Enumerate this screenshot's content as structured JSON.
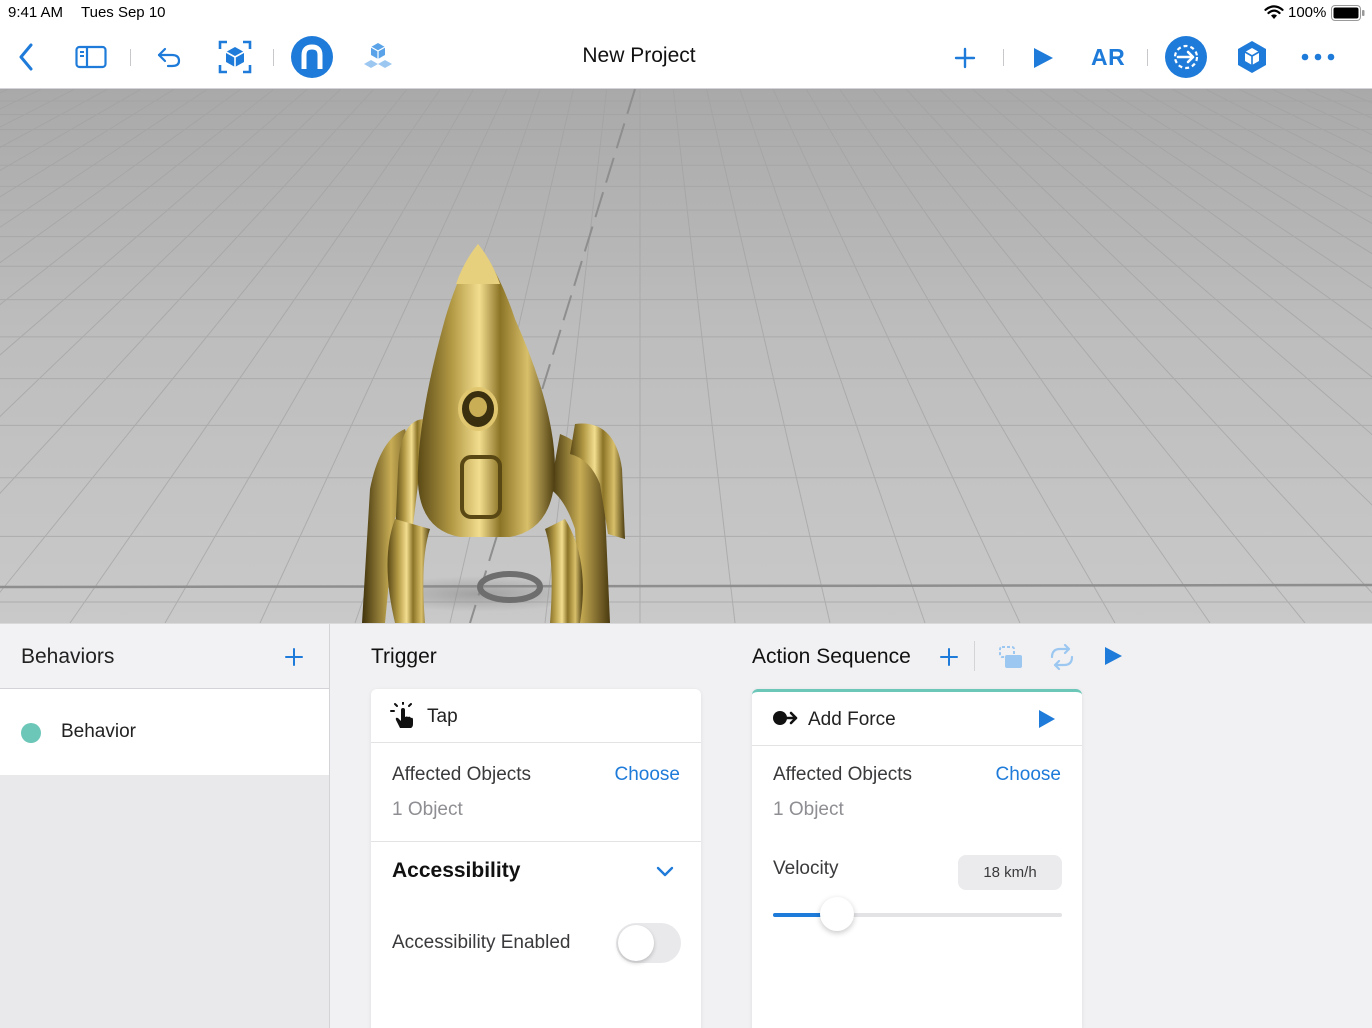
{
  "status": {
    "time": "9:41 AM",
    "date": "Tues Sep 10",
    "battery": "100%"
  },
  "toolbar": {
    "title": "New Project",
    "ar_label": "AR",
    "icons": [
      "back-icon",
      "sidebar-icon",
      "undo-icon",
      "anchor-icon",
      "snap-icon",
      "scene-icon",
      "add-icon",
      "play-icon",
      "behaviors-icon",
      "properties-icon",
      "more-icon"
    ]
  },
  "behaviors": {
    "title": "Behaviors",
    "items": [
      {
        "label": "Behavior",
        "color": "#6cc7b9"
      }
    ]
  },
  "trigger": {
    "title": "Trigger",
    "name": "Tap",
    "affected_label": "Affected Objects",
    "choose": "Choose",
    "count": "1 Object",
    "accessibility_title": "Accessibility",
    "accessibility_enabled_label": "Accessibility Enabled",
    "accessibility_enabled": false
  },
  "actions": {
    "title": "Action Sequence",
    "name": "Add Force",
    "affected_label": "Affected Objects",
    "choose": "Choose",
    "count": "1 Object",
    "velocity_label": "Velocity",
    "velocity_value": "18 km/h",
    "velocity_fraction": 0.22
  },
  "colors": {
    "accent": "#1e7bd9",
    "behavior_dot": "#6cc7b9",
    "card_top": "#6cc7b9"
  }
}
